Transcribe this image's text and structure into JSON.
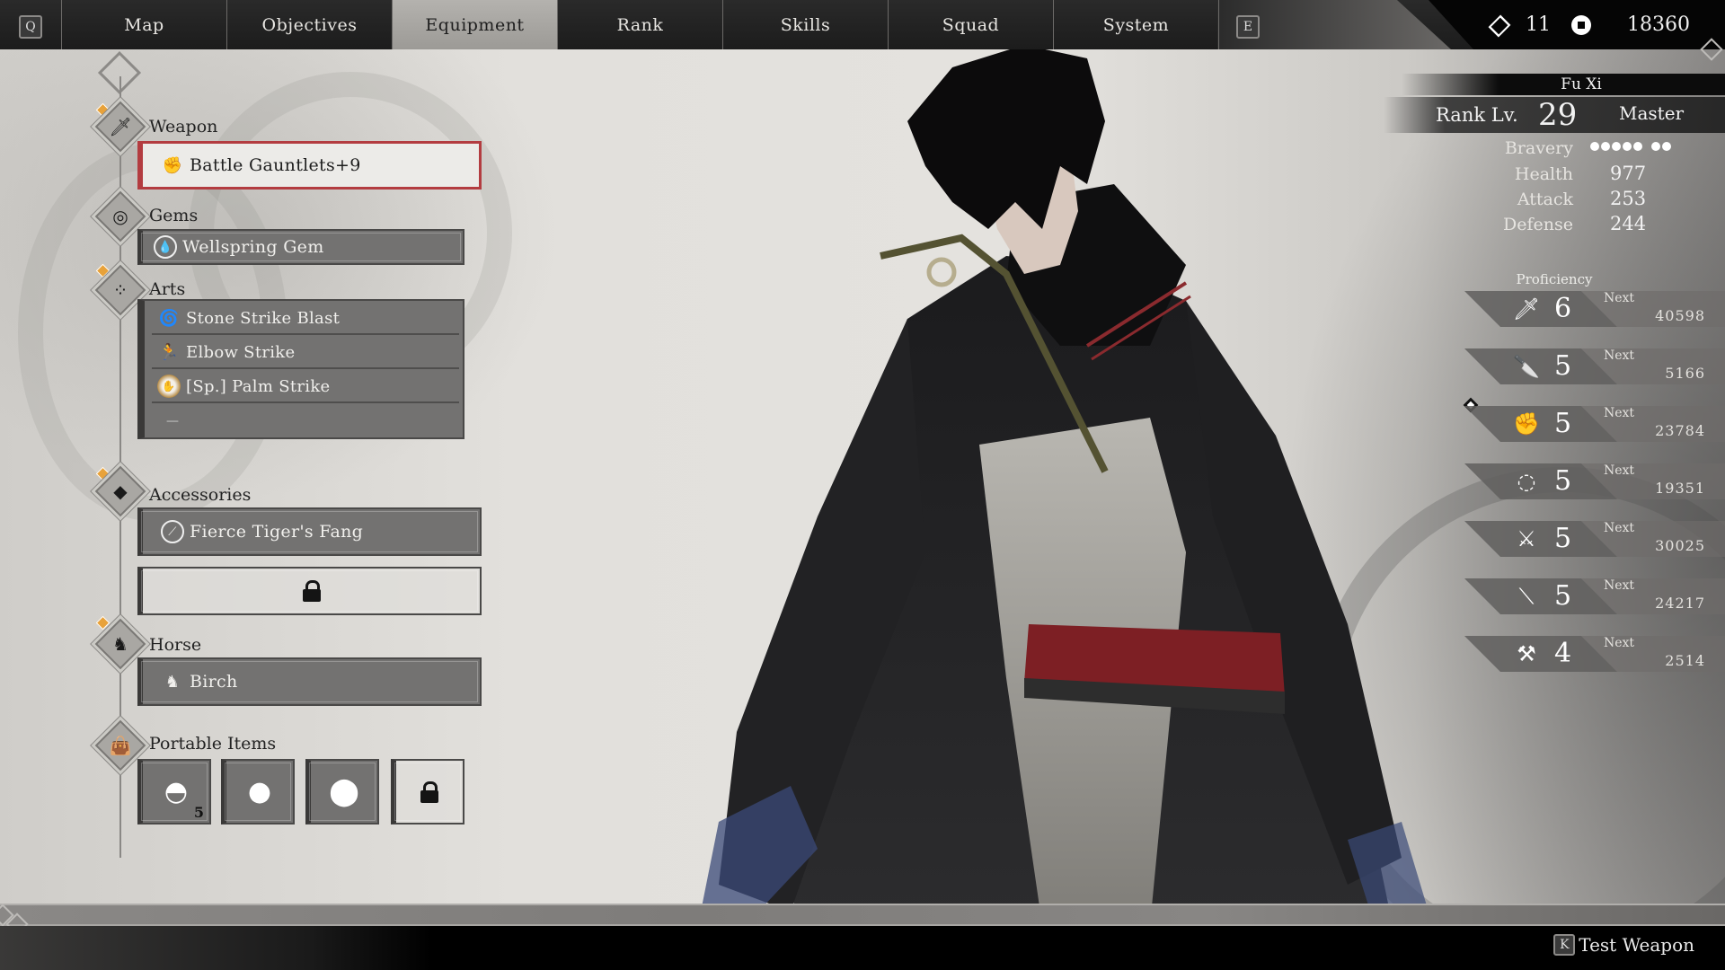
{
  "topbar": {
    "left_key": "Q",
    "right_key": "E",
    "tabs": [
      {
        "label": "Map",
        "active": false
      },
      {
        "label": "Objectives",
        "active": false
      },
      {
        "label": "Equipment",
        "active": true
      },
      {
        "label": "Rank",
        "active": false
      },
      {
        "label": "Skills",
        "active": false
      },
      {
        "label": "Squad",
        "active": false
      },
      {
        "label": "System",
        "active": false
      }
    ],
    "currency": {
      "gems_icon": "diamond-icon",
      "gems_value": "11",
      "coins_icon": "coin-icon",
      "coins_value": "18360"
    }
  },
  "equipment": {
    "weapon": {
      "label": "Weapon",
      "item": "Battle Gauntlets+9",
      "icon": "gauntlet-icon",
      "selected": true
    },
    "gems": {
      "label": "Gems",
      "item": "Wellspring Gem",
      "icon": "water-drop-icon"
    },
    "arts": {
      "label": "Arts",
      "items": [
        {
          "name": "Stone Strike Blast",
          "icon": "whirlwind-icon"
        },
        {
          "name": "Elbow Strike",
          "icon": "running-figure-icon"
        },
        {
          "name": "[Sp.] Palm Strike",
          "icon": "palm-icon"
        },
        {
          "name": "—",
          "icon": ""
        }
      ]
    },
    "accessories": {
      "label": "Accessories",
      "items": [
        {
          "name": "Fierce Tiger's Fang",
          "icon": "fang-icon",
          "locked": false
        },
        {
          "name": "",
          "icon": "lock-icon",
          "locked": true
        }
      ]
    },
    "horse": {
      "label": "Horse",
      "item": "Birch",
      "icon": "horse-head-icon"
    },
    "portable_items": {
      "label": "Portable Items",
      "items": [
        {
          "icon": "bun-icon",
          "count": "5",
          "locked": false
        },
        {
          "icon": "pouch-icon",
          "count": "",
          "locked": false
        },
        {
          "icon": "large-pouch-icon",
          "count": "",
          "locked": false
        },
        {
          "icon": "lock-icon",
          "count": "",
          "locked": true
        }
      ]
    }
  },
  "character": {
    "name": "Fu Xi",
    "rank_label": "Rank Lv.",
    "rank_level": "29",
    "rank_title": "Master",
    "stats": [
      {
        "label": "Bravery",
        "value": "",
        "bravery_pips": 7
      },
      {
        "label": "Health",
        "value": "977"
      },
      {
        "label": "Attack",
        "value": "253"
      },
      {
        "label": "Defense",
        "value": "244"
      }
    ],
    "proficiency_title": "Proficiency",
    "proficiency": [
      {
        "weapon": "sword-icon",
        "level": "6",
        "next_label": "Next",
        "next": "40598",
        "selected": false
      },
      {
        "weapon": "blade-icon",
        "level": "5",
        "next_label": "Next",
        "next": "5166",
        "selected": false
      },
      {
        "weapon": "gauntlet-icon",
        "level": "5",
        "next_label": "Next",
        "next": "23784",
        "selected": true
      },
      {
        "weapon": "ring-blades-icon",
        "level": "5",
        "next_label": "Next",
        "next": "19351",
        "selected": false
      },
      {
        "weapon": "sabre-icon",
        "level": "5",
        "next_label": "Next",
        "next": "30025",
        "selected": false
      },
      {
        "weapon": "staff-icon",
        "level": "5",
        "next_label": "Next",
        "next": "24217",
        "selected": false
      },
      {
        "weapon": "axe-icon",
        "level": "4",
        "next_label": "Next",
        "next": "2514",
        "selected": false
      }
    ]
  },
  "footer": {
    "key": "K",
    "action": "Test Weapon"
  }
}
